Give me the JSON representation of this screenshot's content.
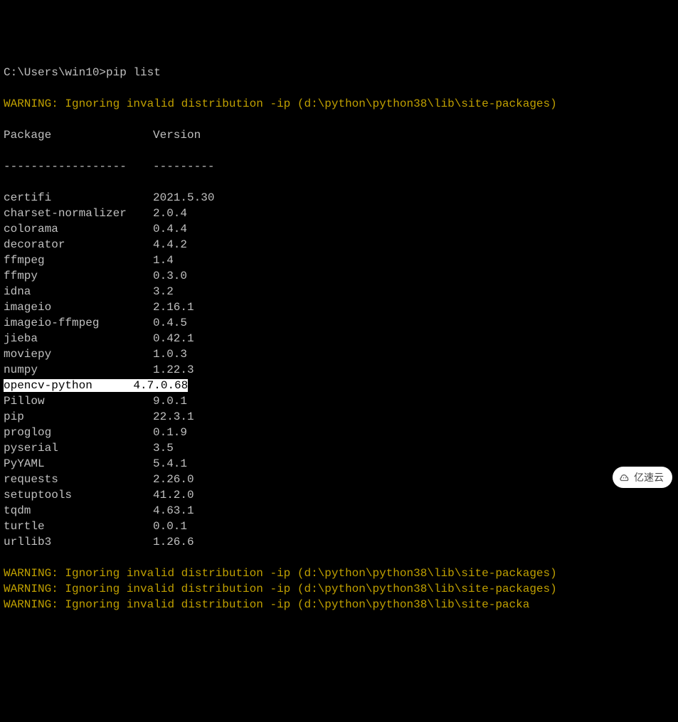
{
  "prompt": "C:\\Users\\win10>pip list",
  "warning_top": "WARNING: Ignoring invalid distribution -ip (d:\\python\\python38\\lib\\site-packages)",
  "header": {
    "col1": "Package",
    "col2": "Version"
  },
  "divider": {
    "col1": "------------------",
    "col2": "---------"
  },
  "packages": [
    {
      "name": "certifi",
      "version": "2021.5.30",
      "highlighted": false
    },
    {
      "name": "charset-normalizer",
      "version": "2.0.4",
      "highlighted": false
    },
    {
      "name": "colorama",
      "version": "0.4.4",
      "highlighted": false
    },
    {
      "name": "decorator",
      "version": "4.4.2",
      "highlighted": false
    },
    {
      "name": "ffmpeg",
      "version": "1.4",
      "highlighted": false
    },
    {
      "name": "ffmpy",
      "version": "0.3.0",
      "highlighted": false
    },
    {
      "name": "idna",
      "version": "3.2",
      "highlighted": false
    },
    {
      "name": "imageio",
      "version": "2.16.1",
      "highlighted": false
    },
    {
      "name": "imageio-ffmpeg",
      "version": "0.4.5",
      "highlighted": false
    },
    {
      "name": "jieba",
      "version": "0.42.1",
      "highlighted": false
    },
    {
      "name": "moviepy",
      "version": "1.0.3",
      "highlighted": false
    },
    {
      "name": "numpy",
      "version": "1.22.3",
      "highlighted": false
    },
    {
      "name": "opencv-python",
      "version": "4.7.0.68",
      "highlighted": true
    },
    {
      "name": "Pillow",
      "version": "9.0.1",
      "highlighted": false
    },
    {
      "name": "pip",
      "version": "22.3.1",
      "highlighted": false
    },
    {
      "name": "proglog",
      "version": "0.1.9",
      "highlighted": false
    },
    {
      "name": "pyserial",
      "version": "3.5",
      "highlighted": false
    },
    {
      "name": "PyYAML",
      "version": "5.4.1",
      "highlighted": false
    },
    {
      "name": "requests",
      "version": "2.26.0",
      "highlighted": false
    },
    {
      "name": "setuptools",
      "version": "41.2.0",
      "highlighted": false
    },
    {
      "name": "tqdm",
      "version": "4.63.1",
      "highlighted": false
    },
    {
      "name": "turtle",
      "version": "0.0.1",
      "highlighted": false
    },
    {
      "name": "urllib3",
      "version": "1.26.6",
      "highlighted": false
    }
  ],
  "warnings_bottom": [
    "WARNING: Ignoring invalid distribution -ip (d:\\python\\python38\\lib\\site-packages)",
    "WARNING: Ignoring invalid distribution -ip (d:\\python\\python38\\lib\\site-packages)",
    "WARNING: Ignoring invalid distribution -ip (d:\\python\\python38\\lib\\site-packa"
  ],
  "watermark": {
    "text": "亿速云",
    "icon": "cloud-icon"
  }
}
